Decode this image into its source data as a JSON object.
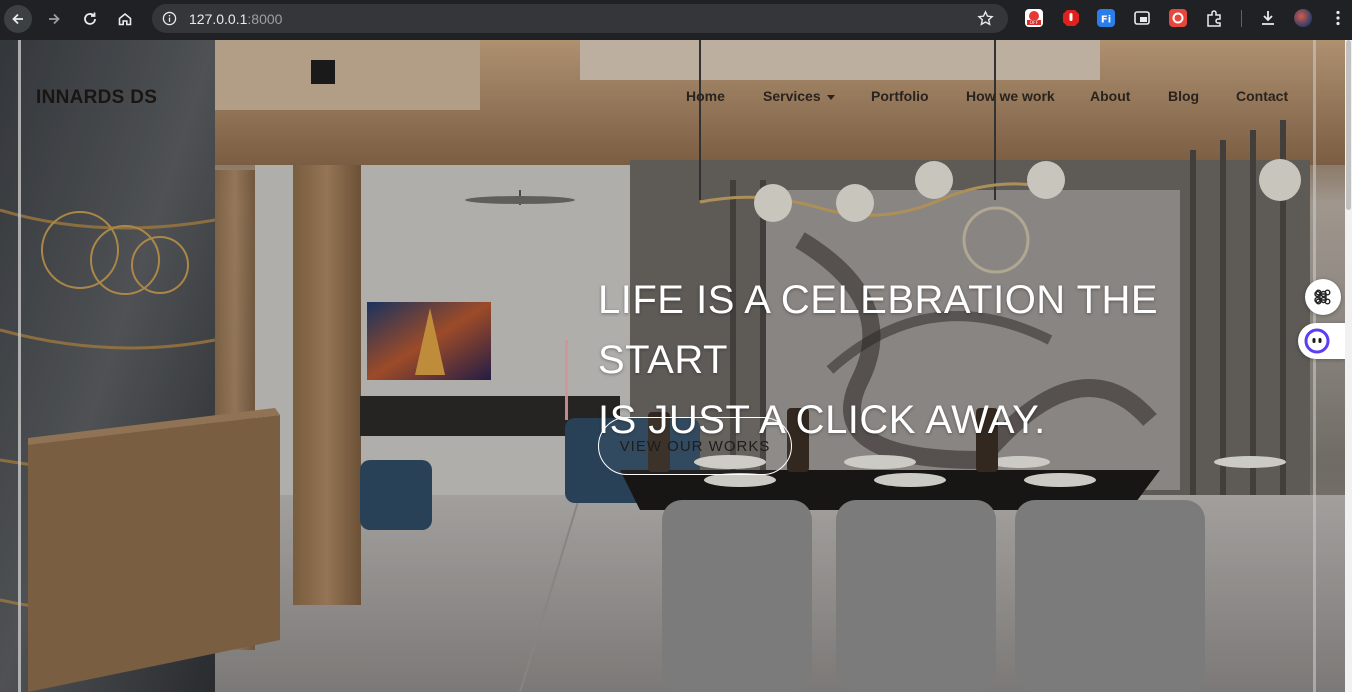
{
  "browser": {
    "url_host": "127.0.0.1",
    "url_port": ":8000",
    "icons": [
      "back-icon",
      "forward-icon",
      "reload-icon",
      "home-icon",
      "site-info-icon",
      "bookmark-star-icon",
      "downloads-icon",
      "profile-avatar",
      "more-menu-icon"
    ],
    "extensions": [
      "coupon-off-extension",
      "adblock-extension",
      "fi-extension",
      "window-extension",
      "record-extension",
      "extensions-puzzle-icon"
    ]
  },
  "site": {
    "logo": "INNARDS DS",
    "nav": [
      {
        "label": "Home"
      },
      {
        "label": "Services"
      },
      {
        "label": "Portfolio"
      },
      {
        "label": "How we work"
      },
      {
        "label": "About"
      },
      {
        "label": "Blog"
      },
      {
        "label": "Contact"
      }
    ]
  },
  "hero": {
    "headline_line1": "LIFE IS A CELEBRATION THE START",
    "headline_line2": "IS JUST A CLICK AWAY.",
    "cta_label": "VIEW OUR WORKS",
    "background": "dining-room-interior-image"
  },
  "colors": {
    "chrome_bg": "#202124",
    "omnibox_bg": "#35363a",
    "headline": "#ffffff",
    "nav_text": "#2a231d"
  }
}
